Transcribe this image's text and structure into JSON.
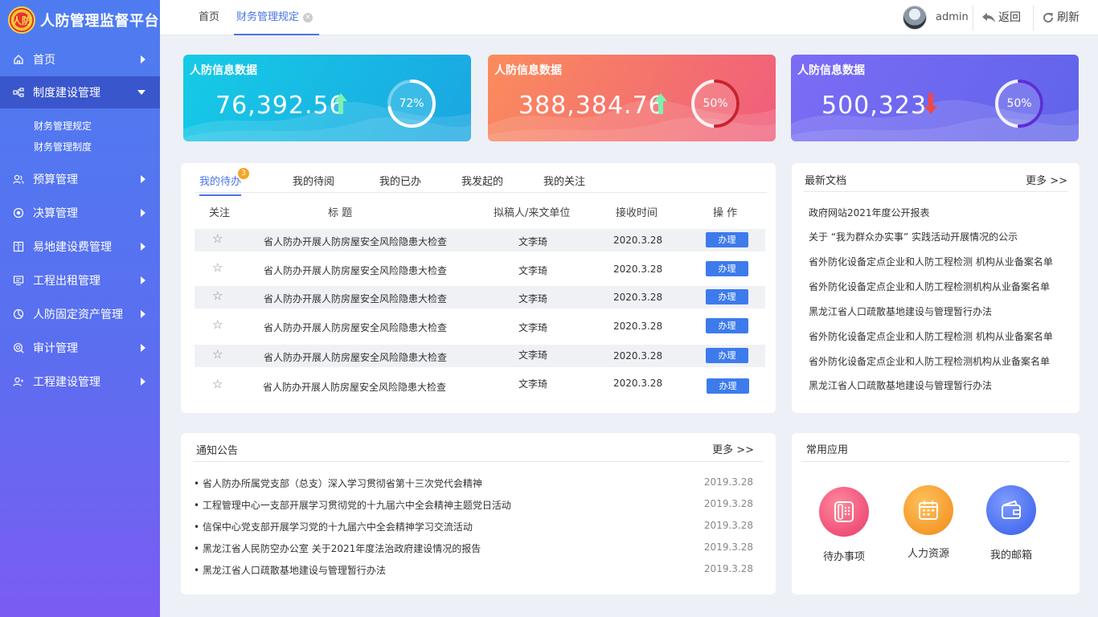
{
  "app": {
    "title": "人防管理监督平台",
    "logo_text": "人防"
  },
  "topbar": {
    "tabs": [
      {
        "label": "首页"
      },
      {
        "label": "财务管理规定"
      }
    ],
    "user": "admin",
    "back_label": "返回",
    "refresh_label": "刷新"
  },
  "sidebar": {
    "items": [
      {
        "label": "首页",
        "icon": "home-icon"
      },
      {
        "label": "制度建设管理",
        "icon": "org-icon",
        "expanded": true,
        "children": [
          {
            "label": "财务管理规定"
          },
          {
            "label": "财务管理制度"
          }
        ]
      },
      {
        "label": "预算管理",
        "icon": "users-icon"
      },
      {
        "label": "决算管理",
        "icon": "target-icon"
      },
      {
        "label": "易地建设费管理",
        "icon": "book-icon"
      },
      {
        "label": "工程出租管理",
        "icon": "monitor-icon"
      },
      {
        "label": "人防固定资产管理",
        "icon": "pie-icon"
      },
      {
        "label": "审计管理",
        "icon": "search-icon"
      },
      {
        "label": "工程建设管理",
        "icon": "user-icon"
      }
    ]
  },
  "stats": [
    {
      "title": "人防信息数据",
      "value": "76,392.56",
      "trend": "up",
      "percent": "72%",
      "percent_value": 72,
      "arrow_color": "#7cf2b2"
    },
    {
      "title": "人防信息数据",
      "value": "388,384.76",
      "trend": "up",
      "percent": "50%",
      "percent_value": 50,
      "arrow_color": "#7cf2b2"
    },
    {
      "title": "人防信息数据",
      "value": "500,323",
      "trend": "down",
      "percent": "50%",
      "percent_value": 50,
      "arrow_color": "#f04848"
    }
  ],
  "todo": {
    "tabs": [
      {
        "label": "我的待办",
        "badge": "3"
      },
      {
        "label": "我的待阅"
      },
      {
        "label": "我的已办"
      },
      {
        "label": "我发起的"
      },
      {
        "label": "我的关注"
      }
    ],
    "headers": [
      "关注",
      "标  题",
      "拟稿人/来文单位",
      "接收时间",
      "操  作"
    ],
    "rows": [
      {
        "title": "省人防办开展人防房屋安全风险隐患大检查",
        "author": "文李琦",
        "date": "2020.3.28",
        "action": "办理"
      },
      {
        "title": "省人防办开展人防房屋安全风险隐患大检查",
        "author": "文李琦",
        "date": "2020.3.28",
        "action": "办理"
      },
      {
        "title": "省人防办开展人防房屋安全风险隐患大检查",
        "author": "文李琦",
        "date": "2020.3.28",
        "action": "办理"
      },
      {
        "title": "省人防办开展人防房屋安全风险隐患大检查",
        "author": "文李琦",
        "date": "2020.3.28",
        "action": "办理"
      },
      {
        "title": "省人防办开展人防房屋安全风险隐患大检查",
        "author": "文李琦",
        "date": "2020.3.28",
        "action": "办理"
      },
      {
        "title": "省人防办开展人防房屋安全风险隐患大检查",
        "author": "文李琦",
        "date": "2020.3.28",
        "action": "办理"
      }
    ]
  },
  "docs": {
    "title": "最新文档",
    "more": "更多 >>",
    "items": [
      "政府网站2021年度公开报表",
      "关于 “我为群众办实事” 实践活动开展情况的公示",
      "省外防化设备定点企业和人防工程检测 机构从业备案名单",
      "省外防化设备定点企业和人防工程检测机构从业备案名单",
      "黑龙江省人口疏散基地建设与管理暂行办法",
      "省外防化设备定点企业和人防工程检测 机构从业备案名单",
      "省外防化设备定点企业和人防工程检测机构从业备案名单",
      "黑龙江省人口疏散基地建设与管理暂行办法"
    ]
  },
  "notice": {
    "title": "通知公告",
    "more": "更多 >>",
    "items": [
      {
        "text": "• 省人防办所属党支部（总支）深入学习贯彻省第十三次党代会精神",
        "date": "2019.3.28"
      },
      {
        "text": "• 工程管理中心一支部开展学习贯彻党的十九届六中全会精神主题党日活动",
        "date": "2019.3.28"
      },
      {
        "text": "• 信保中心党支部开展学习党的十九届六中全会精神学习交流活动",
        "date": "2019.3.28"
      },
      {
        "text": "• 黑龙江省人民防空办公室 关于2021年度法治政府建设情况的报告",
        "date": "2019.3.28"
      },
      {
        "text": "• 黑龙江省人口疏散基地建设与管理暂行办法",
        "date": "2019.3.28"
      }
    ]
  },
  "apps": {
    "title": "常用应用",
    "items": [
      {
        "label": "待办事项",
        "icon": "phone-icon",
        "color": "#f0507a"
      },
      {
        "label": "人力资源",
        "icon": "calendar-icon",
        "color": "#f59a2c"
      },
      {
        "label": "我的邮箱",
        "icon": "wallet-icon",
        "color": "#4a6ff0"
      }
    ]
  }
}
